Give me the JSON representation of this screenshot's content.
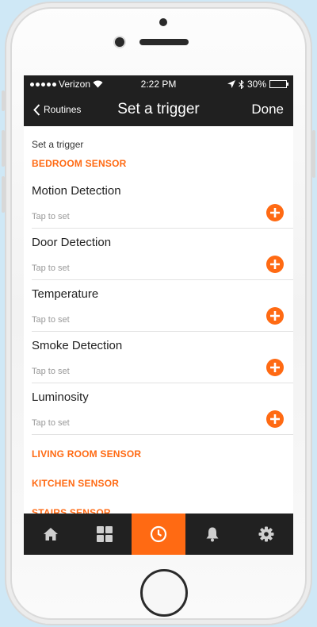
{
  "status_bar": {
    "carrier": "Verizon",
    "time": "2:22 PM",
    "battery_text": "30%",
    "battery_level": 0.3
  },
  "nav": {
    "back_label": "Routines",
    "title": "Set a trigger",
    "done_label": "Done"
  },
  "content": {
    "caption": "Set a trigger",
    "expanded_group": {
      "title": "BEDROOM SENSOR",
      "triggers": [
        {
          "label": "Motion Detection",
          "sub": "Tap to set"
        },
        {
          "label": "Door Detection",
          "sub": "Tap to set"
        },
        {
          "label": "Temperature",
          "sub": "Tap to set"
        },
        {
          "label": "Smoke Detection",
          "sub": "Tap to set"
        },
        {
          "label": "Luminosity",
          "sub": "Tap to set"
        }
      ]
    },
    "other_groups": [
      "LIVING ROOM SENSOR",
      "KITCHEN SENSOR",
      "STAIRS SENSOR"
    ]
  },
  "tabbar": {
    "tabs": [
      {
        "icon": "home-icon",
        "active": false
      },
      {
        "icon": "grid-icon",
        "active": false
      },
      {
        "icon": "clock-icon",
        "active": true
      },
      {
        "icon": "bell-icon",
        "active": false
      },
      {
        "icon": "gear-icon",
        "active": false
      }
    ]
  },
  "colors": {
    "accent": "#ff6a13",
    "bar_background": "#202020",
    "page_background": "#cfe8f6"
  }
}
